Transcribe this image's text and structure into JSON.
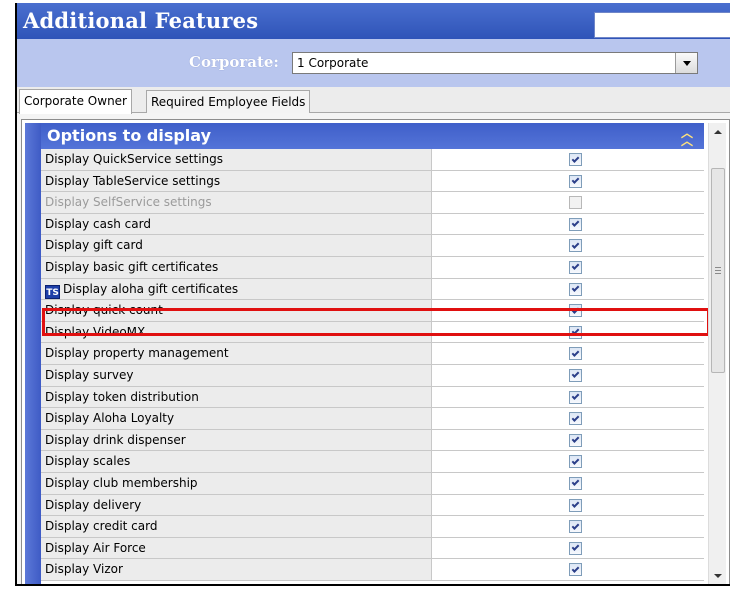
{
  "window": {
    "title": "Additional Features"
  },
  "filter": {
    "label": "Corporate:",
    "selected": "1 Corporate"
  },
  "tabs": [
    {
      "label": "Corporate Owner",
      "active": true
    },
    {
      "label": "Required Employee Fields",
      "active": false
    }
  ],
  "section": {
    "title": "Options to display"
  },
  "options": [
    {
      "label": "Display QuickService settings",
      "checked": true,
      "enabled": true
    },
    {
      "label": "Display TableService settings",
      "checked": true,
      "enabled": true
    },
    {
      "label": "Display SelfService settings",
      "checked": false,
      "enabled": false
    },
    {
      "label": "Display cash card",
      "checked": true,
      "enabled": true
    },
    {
      "label": "Display gift card",
      "checked": true,
      "enabled": true
    },
    {
      "label": "Display basic gift certificates",
      "checked": true,
      "enabled": true
    },
    {
      "label": "Display aloha gift certificates",
      "checked": true,
      "enabled": true,
      "icon": "ts-icon",
      "icon_text": "TS"
    },
    {
      "label": "Display quick count",
      "checked": true,
      "enabled": true,
      "highlighted": true
    },
    {
      "label": "Display VideoMX",
      "checked": true,
      "enabled": true
    },
    {
      "label": "Display property management",
      "checked": true,
      "enabled": true
    },
    {
      "label": "Display survey",
      "checked": true,
      "enabled": true
    },
    {
      "label": "Display token distribution",
      "checked": true,
      "enabled": true
    },
    {
      "label": "Display Aloha Loyalty",
      "checked": true,
      "enabled": true
    },
    {
      "label": "Display drink dispenser",
      "checked": true,
      "enabled": true
    },
    {
      "label": "Display scales",
      "checked": true,
      "enabled": true
    },
    {
      "label": "Display club membership",
      "checked": true,
      "enabled": true
    },
    {
      "label": "Display delivery",
      "checked": true,
      "enabled": true
    },
    {
      "label": "Display credit card",
      "checked": true,
      "enabled": true
    },
    {
      "label": "Display Air Force",
      "checked": true,
      "enabled": true
    },
    {
      "label": "Display Vizor",
      "checked": true,
      "enabled": true
    }
  ],
  "colors": {
    "title_bar": "#3a5fc6",
    "filter_bar": "#b9c6ee",
    "highlight": "#e01010"
  }
}
